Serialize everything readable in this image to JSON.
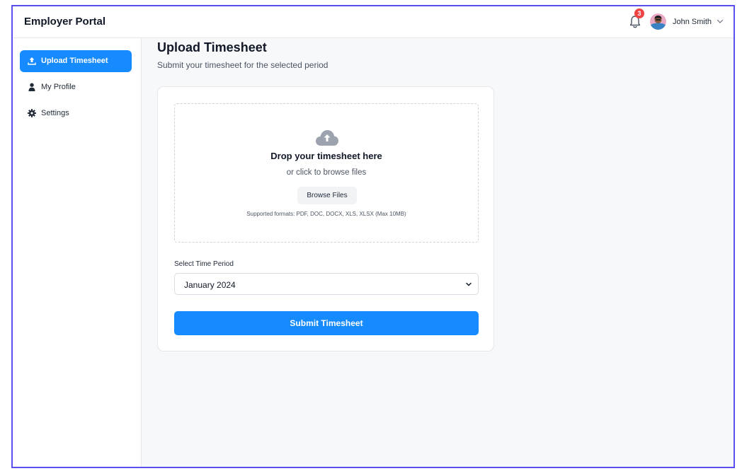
{
  "app": {
    "title": "Employer Portal"
  },
  "header": {
    "notifications_count": "3",
    "user_name": "John Smith"
  },
  "sidebar": {
    "items": [
      {
        "label": "Upload Timesheet",
        "icon": "upload-icon",
        "active": true
      },
      {
        "label": "My Profile",
        "icon": "user-icon",
        "active": false
      },
      {
        "label": "Settings",
        "icon": "gear-icon",
        "active": false
      }
    ]
  },
  "main": {
    "title": "Upload Timesheet",
    "subtitle": "Submit your timesheet for the selected period",
    "dropzone": {
      "title": "Drop your timesheet here",
      "subtitle": "or click to browse files",
      "browse_label": "Browse Files",
      "formats": "Supported formats: PDF, DOC, DOCX, XLS, XLSX (Max 10MB)"
    },
    "period_label": "Select Time Period",
    "period_value": "January 2024",
    "submit_label": "Submit Timesheet"
  },
  "colors": {
    "accent": "#168aff",
    "badge": "#ef4444",
    "frame": "#5b4ff0"
  }
}
